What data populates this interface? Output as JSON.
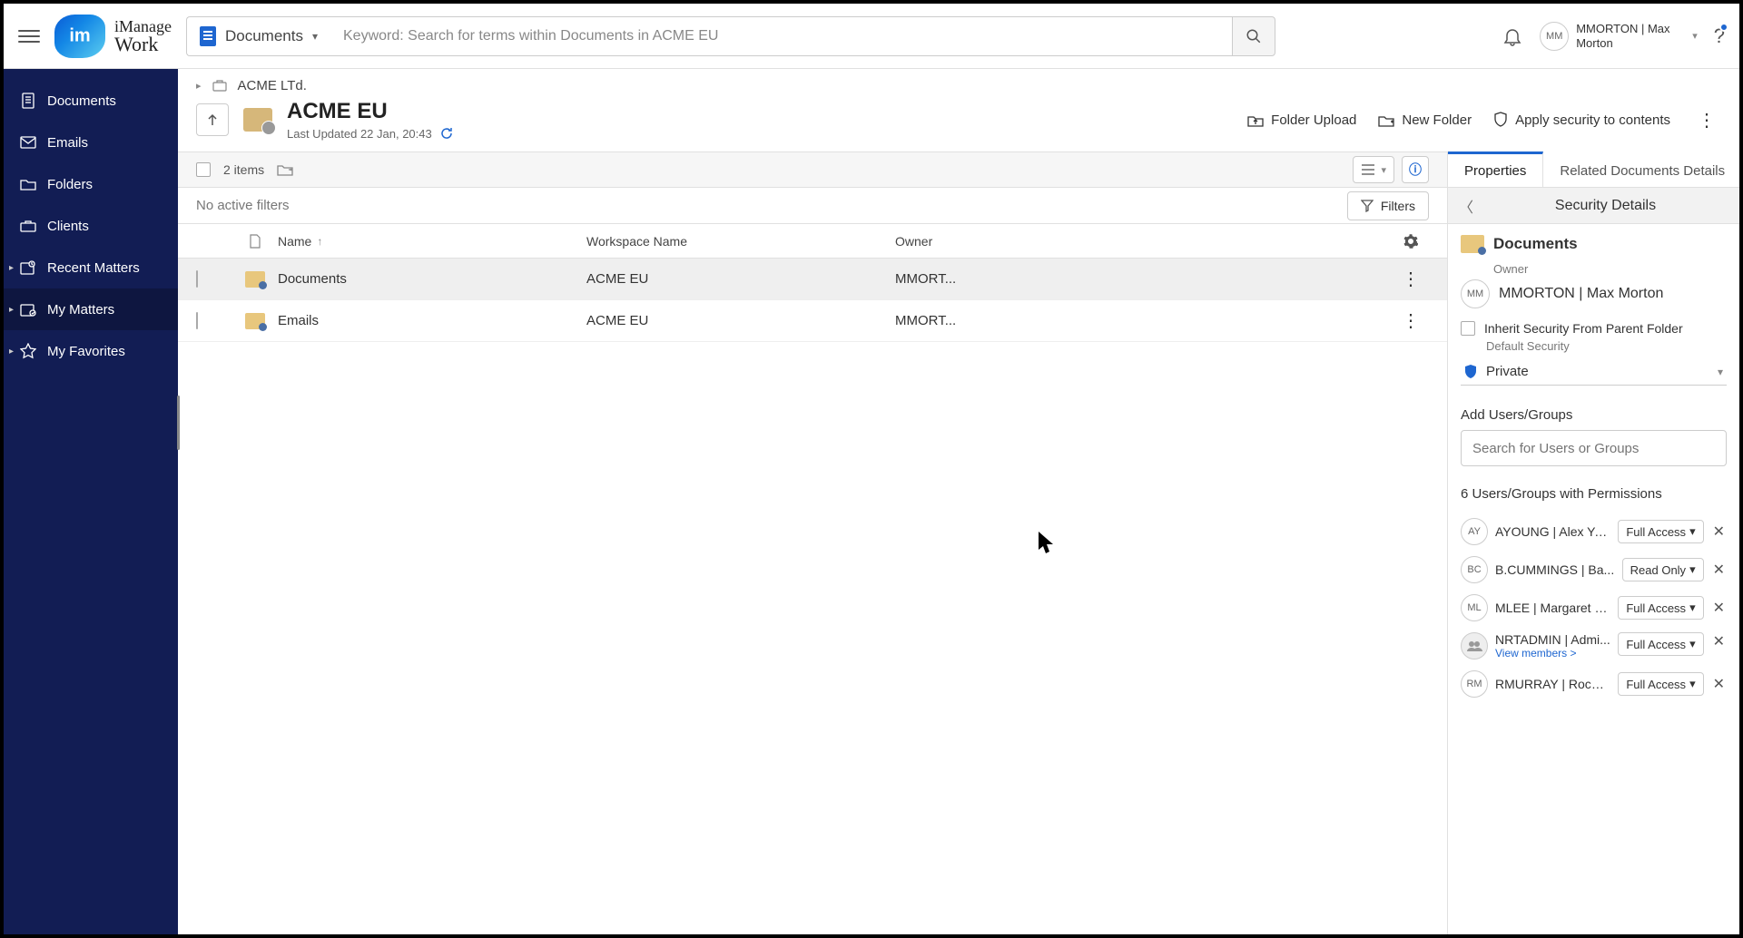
{
  "app": {
    "name_line1": "iManage",
    "name_line2": "Work"
  },
  "search": {
    "scope": "Documents",
    "placeholder": "Keyword: Search for terms within Documents in ACME EU"
  },
  "user": {
    "initials": "MM",
    "display": "MMORTON | Max Morton"
  },
  "sidebar": {
    "items": [
      {
        "label": "Documents"
      },
      {
        "label": "Emails"
      },
      {
        "label": "Folders"
      },
      {
        "label": "Clients"
      },
      {
        "label": "Recent Matters"
      },
      {
        "label": "My Matters"
      },
      {
        "label": "My Favorites"
      }
    ]
  },
  "breadcrumb": {
    "parent": "ACME LTd."
  },
  "workspace": {
    "title": "ACME EU",
    "updated": "Last Updated 22 Jan, 20:43"
  },
  "headerActions": {
    "folderUpload": "Folder Upload",
    "newFolder": "New Folder",
    "applySecurity": "Apply security to contents"
  },
  "toolbar": {
    "count": "2 items"
  },
  "filters": {
    "none": "No active filters",
    "button": "Filters"
  },
  "columns": {
    "name": "Name",
    "workspace": "Workspace Name",
    "owner": "Owner"
  },
  "rows": [
    {
      "name": "Documents",
      "workspace": "ACME EU",
      "owner": "MMORT..."
    },
    {
      "name": "Emails",
      "workspace": "ACME EU",
      "owner": "MMORT..."
    }
  ],
  "panel": {
    "tabs": {
      "properties": "Properties",
      "related": "Related Documents Details"
    },
    "subtitle": "Security Details",
    "docTitle": "Documents",
    "ownerLabel": "Owner",
    "ownerInitials": "MM",
    "ownerName": "MMORTON | Max Morton",
    "inherit": "Inherit Security From Parent Folder",
    "defaultSec": "Default Security",
    "secValue": "Private",
    "addLabel": "Add Users/Groups",
    "addPlaceholder": "Search for Users or Groups",
    "permCount": "6 Users/Groups with Permissions",
    "perms": [
      {
        "initials": "AY",
        "name": "AYOUNG | Alex Yo...",
        "access": "Full Access",
        "group": false
      },
      {
        "initials": "BC",
        "name": "B.CUMMINGS | Ba...",
        "access": "Read Only",
        "group": false
      },
      {
        "initials": "ML",
        "name": "MLEE | Margaret L...",
        "access": "Full Access",
        "group": false
      },
      {
        "initials": "",
        "name": "NRTADMIN | Admi...",
        "access": "Full Access",
        "group": true,
        "sub": "View members >"
      },
      {
        "initials": "RM",
        "name": "RMURRAY | Roche...",
        "access": "Full Access",
        "group": false
      }
    ]
  }
}
